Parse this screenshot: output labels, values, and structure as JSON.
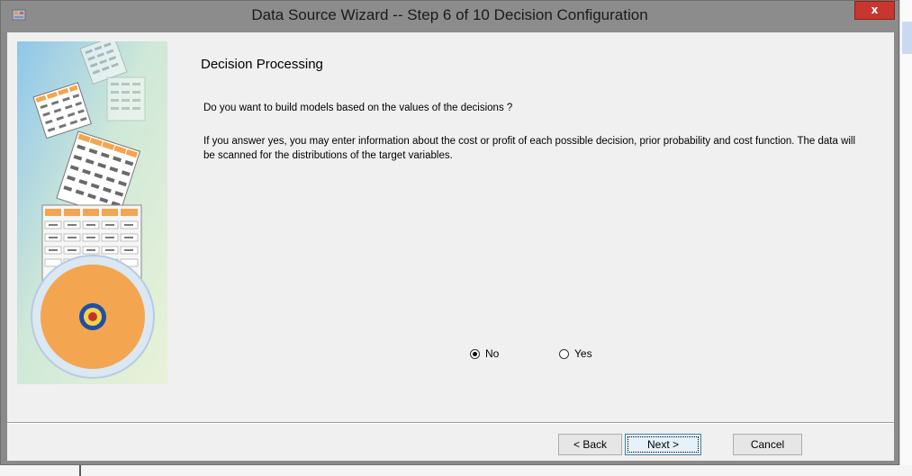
{
  "window": {
    "title": "Data Source Wizard  -- Step 6 of 10  Decision Configuration",
    "close_label": "x"
  },
  "content": {
    "heading": "Decision Processing",
    "question": "Do you want to build models based on the values of the decisions ?",
    "info": "If you answer yes, you may enter information about the cost or profit of each possible decision, prior probability and cost function. The data will be scanned for the distributions of the target variables."
  },
  "decision_options": {
    "selected": "No",
    "options": [
      {
        "label": "No",
        "checked": true
      },
      {
        "label": "Yes",
        "checked": false
      }
    ]
  },
  "buttons": {
    "back": "< Back",
    "next": "Next >",
    "cancel": "Cancel"
  },
  "icons": {
    "app": "wizard-app-icon",
    "side": "data-tables-target-illustration"
  },
  "colors": {
    "titlebar": "#8c8c8c",
    "close": "#c7372e",
    "client": "#f0f0f0",
    "target_orange": "#f3a64f",
    "target_blue": "#1e4fa8"
  }
}
